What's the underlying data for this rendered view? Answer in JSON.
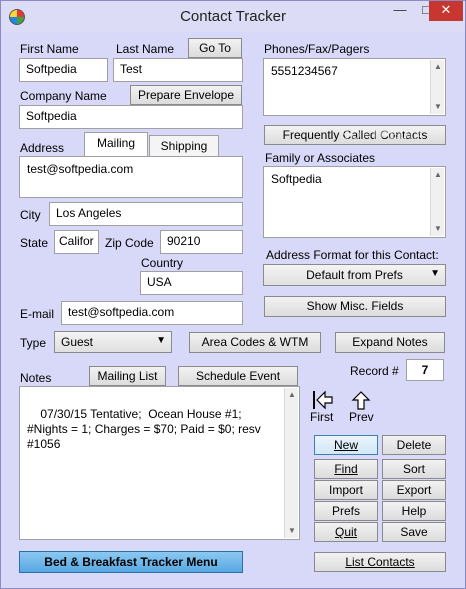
{
  "window": {
    "title": "Contact Tracker",
    "minimize_glyph": "—",
    "maximize_glyph": "□",
    "close_glyph": "✕"
  },
  "name": {
    "first_label": "First Name",
    "first_value": "Softpedia",
    "last_label": "Last Name",
    "last_value": "Test",
    "goto_button": "Go To"
  },
  "company": {
    "label": "Company Name",
    "value": "Softpedia",
    "envelope_button": "Prepare Envelope"
  },
  "address": {
    "label": "Address",
    "tab_mailing": "Mailing",
    "tab_shipping": "Shipping",
    "value": "test@softpedia.com",
    "city_label": "City",
    "city_value": "Los Angeles",
    "state_label": "State",
    "state_value": "Califor",
    "zip_label": "Zip Code",
    "zip_value": "90210",
    "country_label": "Country",
    "country_value": "USA"
  },
  "email": {
    "label": "E-mail",
    "value": "test@softpedia.com"
  },
  "type": {
    "label": "Type",
    "value": "Guest"
  },
  "phones": {
    "label": "Phones/Fax/Pagers",
    "value": "5551234567",
    "frequent_button": "Frequently Called Contacts"
  },
  "family": {
    "label": "Family or Associates",
    "value": "Softpedia"
  },
  "address_format": {
    "label": "Address Format for this Contact:",
    "value": "Default from Prefs"
  },
  "misc_button": "Show Misc. Fields",
  "area_codes_button": "Area Codes & WTM",
  "expand_notes_button": "Expand Notes",
  "notes": {
    "label": "Notes",
    "mailing_list_button": "Mailing List",
    "schedule_button": "Schedule Event",
    "value": "07/30/15 Tentative;  Ocean House #1;\n#Nights = 1; Charges = $70; Paid = $0; resv\n#1056"
  },
  "record": {
    "label": "Record #",
    "value": "7"
  },
  "nav": {
    "first_label": "First",
    "prev_label": "Prev"
  },
  "actions": {
    "new": "New",
    "delete": "Delete",
    "find": "Find",
    "sort": "Sort",
    "import": "Import",
    "export": "Export",
    "prefs": "Prefs",
    "help": "Help",
    "quit": "Quit",
    "save": "Save",
    "list_contacts": "List Contacts"
  },
  "bnb_menu_button": "Bed & Breakfast Tracker Menu",
  "watermark": "SOFTPEDIA"
}
